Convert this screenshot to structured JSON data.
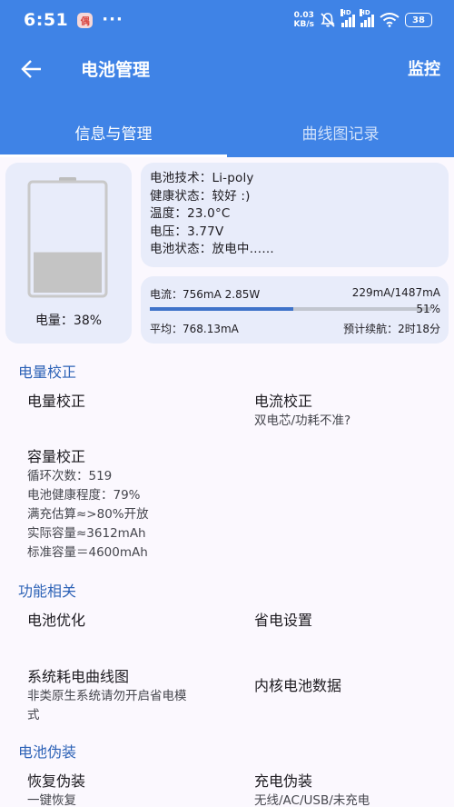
{
  "status_bar": {
    "time": "6:51",
    "app_badge": "偶",
    "dots": "···",
    "net_speed_value": "0.03",
    "net_speed_unit": "KB/s",
    "hd1": "HD",
    "hd2": "HD",
    "battery_level": "38"
  },
  "toolbar": {
    "title": "电池管理",
    "monitor_label": "监控"
  },
  "tabs": [
    {
      "label": "信息与管理"
    },
    {
      "label": "曲线图记录"
    }
  ],
  "battery_card": {
    "level_label": "电量：38%",
    "level_fraction": 0.38
  },
  "info_card": {
    "lines": [
      "电池技术：Li-poly",
      "健康状态：较好 :)",
      "温度：23.0°C",
      "电压：3.77V",
      "电池状态：放电中……"
    ]
  },
  "current_card": {
    "current": "电流：756mA  2.85W",
    "range": "229mA/1487mA",
    "percent": "51%",
    "percent_value": 51,
    "average": "平均：768.13mA",
    "estimate": "预计续航：2时18分"
  },
  "sections": {
    "calibration": {
      "header": "电量校正",
      "battery_cal": {
        "title": "电量校正"
      },
      "current_cal": {
        "title": "电流校正",
        "sub": "双电芯/功耗不准?"
      },
      "capacity_cal": {
        "title": "容量校正",
        "lines": [
          "循环次数：519",
          "电池健康程度：79%",
          "满充估算≈>80%开放",
          "实际容量≈3612mAh",
          "标准容量＝4600mAh"
        ]
      }
    },
    "features": {
      "header": "功能相关",
      "battery_opt": {
        "title": "电池优化"
      },
      "power_saving": {
        "title": "省电设置"
      },
      "system_curve": {
        "title": "系统耗电曲线图",
        "sub": [
          "非类原生系统请勿开启省电模",
          "式"
        ]
      },
      "kernel_data": {
        "title": "内核电池数据"
      }
    },
    "disguise": {
      "header": "电池伪装",
      "restore": {
        "title": "恢复伪装",
        "sub": "一键恢复"
      },
      "charge": {
        "title": "充电伪装",
        "sub": "无线/AC/USB/未充电"
      }
    }
  },
  "colors": {
    "primary": "#3f83e6",
    "section_header": "#2e63b7",
    "card_bg": "#e8ecfa",
    "battery_fill": "#c4c4c4"
  }
}
